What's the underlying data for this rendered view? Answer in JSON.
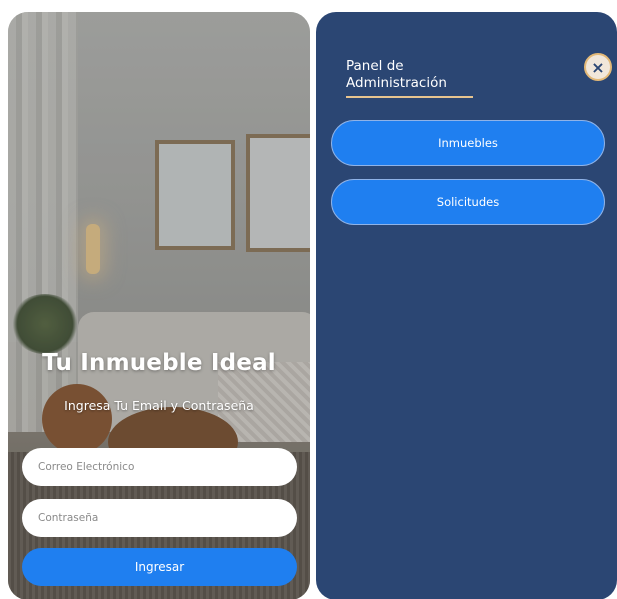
{
  "login": {
    "title": "Tu Inmueble Ideal",
    "subtitle": "Ingresa Tu Email y Contraseña",
    "email_placeholder": "Correo Electrónico",
    "password_placeholder": "Contraseña",
    "submit_label": "Ingresar"
  },
  "admin": {
    "title_line1": "Panel de",
    "title_line2": "Administración",
    "close_icon": "×",
    "menu": [
      {
        "label": "Inmuebles"
      },
      {
        "label": "Solicitudes"
      }
    ]
  },
  "colors": {
    "accent_blue": "#1f7ff0",
    "admin_bg": "#2b4673",
    "gold": "#e3b978"
  }
}
